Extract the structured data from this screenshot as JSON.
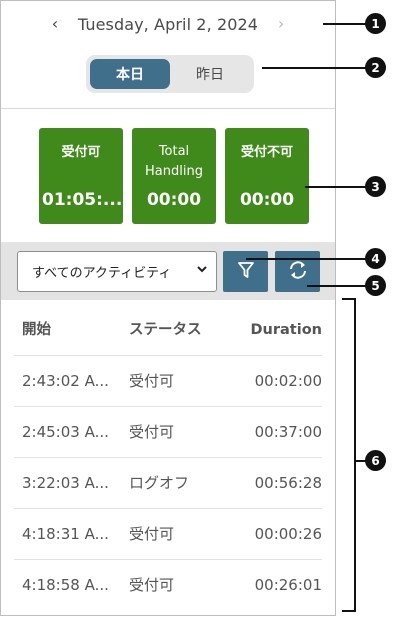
{
  "date_nav": {
    "prev": "‹",
    "date": "Tuesday, April 2, 2024",
    "next": "›"
  },
  "segments": {
    "today": "本日",
    "yesterday": "昨日"
  },
  "tiles": [
    {
      "label": "受付可",
      "value": "01:05:..."
    },
    {
      "label": "Total Handling",
      "value": "00:00"
    },
    {
      "label": "受付不可",
      "value": "00:00"
    }
  ],
  "toolbar": {
    "activity_select": "すべてのアクティビティ"
  },
  "table": {
    "headers": [
      "開始",
      "ステータス",
      "Duration"
    ],
    "rows": [
      [
        "2:43:02 A...",
        "受付可",
        "00:02:00"
      ],
      [
        "2:45:03 A...",
        "受付可",
        "00:37:00"
      ],
      [
        "3:22:03 A...",
        "ログオフ",
        "00:56:28"
      ],
      [
        "4:18:31 A...",
        "受付可",
        "00:00:26"
      ],
      [
        "4:18:58 A...",
        "受付可",
        "00:26:01"
      ]
    ]
  },
  "callouts": [
    "1",
    "2",
    "3",
    "4",
    "5",
    "6"
  ],
  "colors": {
    "accent_blue": "#3f6f8a",
    "tile_green": "#3f8a1a",
    "toolbar_gray": "#e3e3e3"
  },
  "icons": {
    "prev": "chevron-left-icon",
    "next": "chevron-right-icon",
    "filter": "filter-icon",
    "refresh": "refresh-icon"
  }
}
